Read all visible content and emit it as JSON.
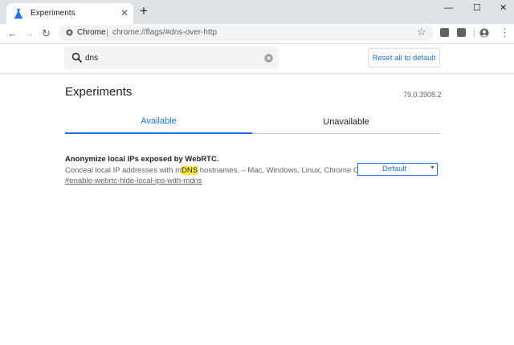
{
  "window": {
    "tab_title": "Experiments",
    "tab_close": "✕",
    "new_tab": "+",
    "minimize": "—",
    "maximize": "☐",
    "close": "✕"
  },
  "toolbar": {
    "back": "←",
    "forward": "→",
    "reload": "↻",
    "origin_label": "Chrome",
    "url": "chrome://flags/#dns-over-http",
    "bookmark": "☆",
    "menu": "⋮"
  },
  "search": {
    "value": "dns"
  },
  "header": {
    "reset_label": "Reset all to default",
    "title": "Experiments",
    "version": "79.0.3908.2"
  },
  "tabs": {
    "available": "Available",
    "unavailable": "Unavailable"
  },
  "experiment": {
    "title": "Anonymize local IPs exposed by WebRTC.",
    "desc_before": "Conceal local IP addresses with m",
    "desc_highlight": "DNS",
    "desc_after": " hostnames. – Mac, Windows, Linux, Chrome OS",
    "link": "#enable-webrtc-hide-local-ips-with-mdns",
    "select_value": "Default",
    "select_arrow": "▼"
  },
  "colors": {
    "accent": "#1a73e8",
    "highlight": "#ffeb3b",
    "frame": "#dee1e6"
  }
}
